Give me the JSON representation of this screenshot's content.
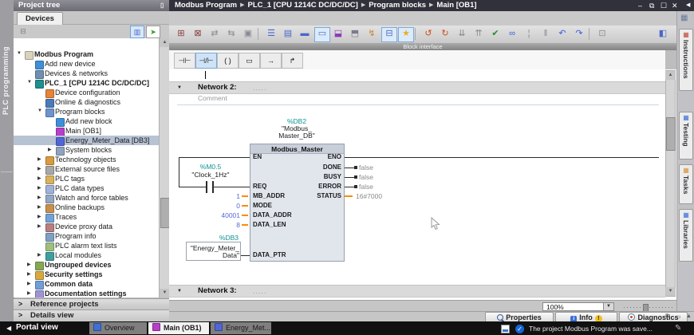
{
  "colors": {
    "teal_operand": "#0f9292",
    "blue_constant": "#5668d8",
    "orange_wire": "#ff8a00",
    "gray_status": "#8a8a8a",
    "selection": "#b7c3d3"
  },
  "titlebar": {
    "breadcrumb": [
      "Modbus Program",
      "PLC_1 [CPU 1214C DC/DC/DC]",
      "Program blocks",
      "Main [OB1]"
    ],
    "separator": "▶",
    "window_controls": [
      "–",
      "⧉",
      "☐",
      "✕"
    ],
    "dock_arrow": "◀"
  },
  "left_rail": {
    "label": "PLC programming"
  },
  "project_tree": {
    "title": "Project tree",
    "header_icons": [
      "▯",
      "◀"
    ],
    "devices_tab": "Devices",
    "items": [
      {
        "label": "Modbus Program",
        "level": 0,
        "arrow": "down",
        "icon": "project-folder-icon",
        "color": "#d9d2bd",
        "bold": true
      },
      {
        "label": "Add new device",
        "level": 1,
        "icon": "add-device-icon",
        "color": "#3f8fd8"
      },
      {
        "label": "Devices & networks",
        "level": 1,
        "icon": "devices-networks-icon",
        "color": "#6f8fb0"
      },
      {
        "label": "PLC_1 [CPU 1214C DC/DC/DC]",
        "level": 1,
        "arrow": "down",
        "icon": "plc-icon",
        "color": "#1f8f8f",
        "bold": true
      },
      {
        "label": "Device configuration",
        "level": 2,
        "icon": "device-config-icon",
        "color": "#e8833a"
      },
      {
        "label": "Online & diagnostics",
        "level": 2,
        "icon": "online-diagnostics-icon",
        "color": "#4a7ab8"
      },
      {
        "label": "Program blocks",
        "level": 2,
        "arrow": "down",
        "icon": "program-blocks-icon",
        "color": "#6f93cf"
      },
      {
        "label": "Add new block",
        "level": 3,
        "icon": "add-block-icon",
        "color": "#3f8fd8"
      },
      {
        "label": "Main [OB1]",
        "level": 3,
        "icon": "ob-block-icon",
        "color": "#b83fc8"
      },
      {
        "label": "Energy_Meter_Data [DB3]",
        "level": 3,
        "icon": "db-block-icon",
        "color": "#5166d6",
        "selected": true
      },
      {
        "label": "System blocks",
        "level": 3,
        "arrow": "right",
        "icon": "system-blocks-icon",
        "color": "#8fa3bf"
      },
      {
        "label": "Technology objects",
        "level": 2,
        "arrow": "right",
        "icon": "technology-objects-icon",
        "color": "#d89b3f"
      },
      {
        "label": "External source files",
        "level": 2,
        "arrow": "right",
        "icon": "external-sources-icon",
        "color": "#a8a8a8"
      },
      {
        "label": "PLC tags",
        "level": 2,
        "arrow": "right",
        "icon": "plc-tags-icon",
        "color": "#d8b25f"
      },
      {
        "label": "PLC data types",
        "level": 2,
        "arrow": "right",
        "icon": "plc-data-types-icon",
        "color": "#9fb3d8"
      },
      {
        "label": "Watch and force tables",
        "level": 2,
        "arrow": "right",
        "icon": "watch-tables-icon",
        "color": "#93a8c4"
      },
      {
        "label": "Online backups",
        "level": 2,
        "arrow": "right",
        "icon": "online-backups-icon",
        "color": "#c78f4f"
      },
      {
        "label": "Traces",
        "level": 2,
        "arrow": "right",
        "icon": "traces-icon",
        "color": "#6fa3d8"
      },
      {
        "label": "Device proxy data",
        "level": 2,
        "arrow": "right",
        "icon": "device-proxy-icon",
        "color": "#b77f7f"
      },
      {
        "label": "Program info",
        "level": 2,
        "icon": "program-info-icon",
        "color": "#7f9fc3"
      },
      {
        "label": "PLC alarm text lists",
        "level": 2,
        "icon": "alarm-texts-icon",
        "color": "#9fbf7f"
      },
      {
        "label": "Local modules",
        "level": 2,
        "arrow": "right",
        "icon": "local-modules-icon",
        "color": "#3f9f9f"
      },
      {
        "label": "Ungrouped devices",
        "level": 1,
        "arrow": "right",
        "icon": "ungrouped-devices-icon",
        "color": "#86a855",
        "bold": true
      },
      {
        "label": "Security settings",
        "level": 1,
        "arrow": "right",
        "icon": "security-settings-icon",
        "color": "#d8a83f",
        "bold": true
      },
      {
        "label": "Common data",
        "level": 1,
        "arrow": "right",
        "icon": "common-data-icon",
        "color": "#6f9fd8",
        "bold": true
      },
      {
        "label": "Documentation settings",
        "level": 1,
        "arrow": "right",
        "icon": "documentation-settings-icon",
        "color": "#9f93d8",
        "bold": true
      }
    ]
  },
  "panels": {
    "reference_projects": "Reference projects",
    "details_view": "Details view"
  },
  "editor": {
    "toolbar": [
      {
        "name": "insert-network-icon",
        "glyph": "⊞",
        "color": "#8a3a3a"
      },
      {
        "name": "delete-network-icon",
        "glyph": "⊠",
        "color": "#8a3a3a"
      },
      {
        "name": "absolute-operands-icon",
        "glyph": "⇄",
        "color": "#8a8a92"
      },
      {
        "name": "operand-info-icon",
        "glyph": "⇆",
        "color": "#8a8a92"
      },
      {
        "name": "keep-layout-icon",
        "glyph": "▣",
        "color": "#8a8a92"
      },
      {
        "sep": true
      },
      {
        "name": "expand-networks-icon",
        "glyph": "☰",
        "color": "#4a66c8"
      },
      {
        "name": "collapse-networks-icon",
        "glyph": "▤",
        "color": "#4a66c8"
      },
      {
        "name": "network-sequence-icon",
        "glyph": "▬",
        "color": "#4a66c8"
      },
      {
        "name": "toggle-comments-icon",
        "glyph": "▭",
        "color": "#4a66c8",
        "boxed": true
      },
      {
        "name": "insert-fb-icon",
        "glyph": "⬓",
        "color": "#8a3ab8"
      },
      {
        "name": "insert-box-icon",
        "glyph": "⬒",
        "color": "#7a7a8a"
      },
      {
        "name": "insert-branch-icon",
        "glyph": "↯",
        "color": "#c8822a"
      },
      {
        "name": "free-form-comments-icon",
        "glyph": "⊟",
        "color": "#4a66c8",
        "boxed": true
      },
      {
        "name": "favorites-toggle-icon",
        "glyph": "★",
        "color": "#e8b020",
        "boxed": true
      },
      {
        "sep": true
      },
      {
        "name": "go-online-icon",
        "glyph": "↺",
        "color": "#d04a18"
      },
      {
        "name": "go-offline-icon",
        "glyph": "↻",
        "color": "#d04a18"
      },
      {
        "name": "download-icon",
        "glyph": "⇊",
        "color": "#8a8a92"
      },
      {
        "name": "upload-icon",
        "glyph": "⇈",
        "color": "#8a8a92"
      },
      {
        "name": "compile-icon",
        "glyph": "✔",
        "color": "#2a8a2a"
      },
      {
        "name": "monitoring-icon",
        "glyph": "∞",
        "color": "#3a5fd8"
      },
      {
        "name": "show-io-icon",
        "glyph": "¦",
        "color": "#8a8a92"
      },
      {
        "name": "hide-io-icon",
        "glyph": "‖",
        "color": "#8a8a92"
      },
      {
        "name": "call-env-icon",
        "glyph": "↶",
        "color": "#3a5fd8"
      },
      {
        "name": "call-path-icon",
        "glyph": "↷",
        "color": "#3a5fd8"
      },
      {
        "sep": true
      },
      {
        "name": "snapshot-icon",
        "glyph": "⊡",
        "color": "#8a8a92"
      }
    ],
    "toolbar_right_icon": {
      "name": "editor-settings-icon",
      "glyph": "◧",
      "color": "#4a66c8"
    },
    "block_interface_label": "Block interface",
    "favorites": [
      {
        "name": "no-contact-icon",
        "glyph": "⊣⊢"
      },
      {
        "name": "nc-contact-icon",
        "glyph": "⊣/⊢",
        "active": true
      },
      {
        "name": "coil-icon",
        "glyph": "( )"
      },
      {
        "name": "empty-box-icon",
        "glyph": "▭"
      },
      {
        "name": "open-branch-icon",
        "glyph": "→"
      },
      {
        "name": "close-branch-icon",
        "glyph": "↱"
      }
    ],
    "network2": {
      "label": "Network 2:",
      "title_dots": ".....",
      "comment_placeholder": "Comment"
    },
    "network3": {
      "label": "Network 3:",
      "title_dots": "....."
    },
    "rung": {
      "instance_db": {
        "address": "%DB2",
        "name1": "\"Modbus_",
        "name2": "Master_DB\""
      },
      "contact": {
        "address": "%M0.5",
        "name": "\"Clock_1Hz\""
      },
      "block_title": "Modbus_Master",
      "inputs": [
        {
          "pin": "EN"
        },
        {
          "pin": "REQ"
        },
        {
          "pin": "MB_ADDR",
          "value": "1"
        },
        {
          "pin": "MODE",
          "value": "0"
        },
        {
          "pin": "DATA_ADDR",
          "value": "40001"
        },
        {
          "pin": "DATA_LEN",
          "value": "8"
        },
        {
          "pin": "DATA_PTR"
        }
      ],
      "data_ptr_operand": {
        "address": "%DB3",
        "name1": "\"Energy_Meter_",
        "name2": "Data\""
      },
      "outputs": [
        {
          "pin": "ENO"
        },
        {
          "pin": "DONE",
          "value": "false"
        },
        {
          "pin": "BUSY",
          "value": "false"
        },
        {
          "pin": "ERROR",
          "value": "false"
        },
        {
          "pin": "STATUS",
          "value": "16#7000"
        }
      ]
    },
    "zoom_value": "100%"
  },
  "inspector": {
    "tabs": [
      {
        "label": "Properties"
      },
      {
        "label": "Info",
        "badge": "!"
      },
      {
        "label": "Diagnostics"
      }
    ]
  },
  "right_tabs": [
    {
      "label": "Instructions",
      "icon": "instructions-icon",
      "color": "#c04a3a"
    },
    {
      "label": "Testing",
      "icon": "testing-icon",
      "color": "#3a6fd8"
    },
    {
      "label": "Tasks",
      "icon": "tasks-icon",
      "color": "#d8923a"
    },
    {
      "label": "Libraries",
      "icon": "libraries-icon",
      "color": "#3a6fd8"
    }
  ],
  "taskbar": {
    "portal_label": "Portal view",
    "tabs": [
      {
        "label": "Overview",
        "icon_color": "#3f6fd8",
        "active": false
      },
      {
        "label": "Main (OB1)",
        "icon_color": "#b83fc8",
        "active": true
      },
      {
        "label": "Energy_Met...",
        "icon_color": "#5166d6",
        "active": false
      }
    ],
    "status_message": "The project Modbus Program was save..."
  }
}
